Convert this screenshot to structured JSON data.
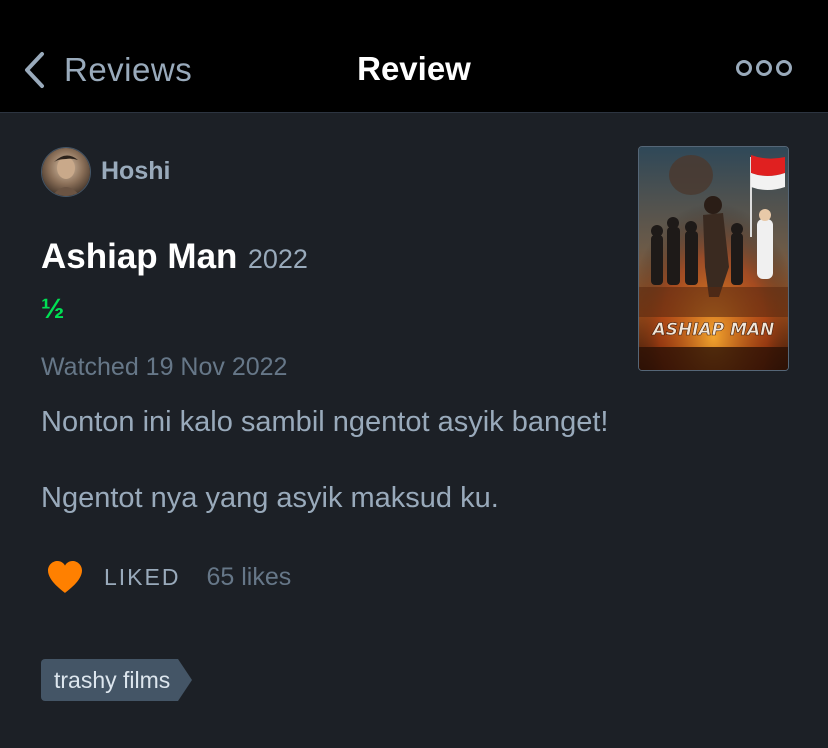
{
  "nav": {
    "back_label": "Reviews",
    "title": "Review"
  },
  "review": {
    "username": "Hoshi",
    "film_title": "Ashiap Man",
    "film_year": "2022",
    "rating": "½",
    "watched": "Watched 19 Nov 2022",
    "paragraphs": [
      "Nonton ini kalo sambil ngentot asyik banget!",
      "Ngentot nya yang asyik maksud ku."
    ],
    "liked_label": "LIKED",
    "likes_count": "65 likes",
    "tags": [
      "trashy films"
    ],
    "poster_text": "ASHIAP MAN"
  },
  "colors": {
    "nav_background": "#000000",
    "page_background": "#1c2026",
    "rating_green": "#00e054",
    "heart_orange": "#ff8000",
    "muted_text": "#99aabb",
    "tag_background": "#445566"
  },
  "icons": {
    "back": "chevron-left-icon",
    "more": "ellipsis-icon",
    "like": "heart-icon"
  }
}
